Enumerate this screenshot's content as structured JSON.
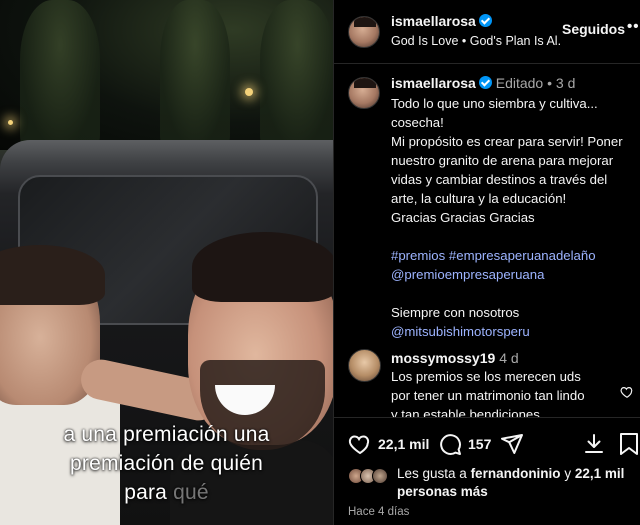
{
  "video": {
    "caption_line1": "a una premiación una",
    "caption_line2": "premiación de quién",
    "caption_line3_start": "para ",
    "caption_line3_faded": "qué"
  },
  "header": {
    "username": "ismaellarosa",
    "subtitle": "God Is Love • God's Plan Is Al...",
    "follow_label": "Seguidos",
    "more_label": "•••"
  },
  "post": {
    "username": "ismaellarosa",
    "edited": "Editado",
    "separator": "•",
    "time": "3 d",
    "lines": [
      "Todo lo que uno siembra y cultiva...",
      "cosecha!",
      "Mi propósito es crear para servir! Poner",
      "nuestro granito de arena para mejorar",
      "vidas y cambiar destinos a través del",
      "arte, la cultura y la educación!",
      "Gracias Gracias Gracias"
    ],
    "hashtag1": "#premios",
    "hashtag2": "#empresaperuanadelaño",
    "mention1": "@premioempresaperuana",
    "closing": "Siempre con nosotros",
    "mention2": "@mitsubishimotorsperu"
  },
  "comment": {
    "username": "mossymossy19",
    "time": "4 d",
    "lines": [
      "Los premios se los merecen uds",
      "por tener un matrimonio tan lindo",
      "y tan estable bendiciones"
    ]
  },
  "actions": {
    "likes_count": "22,1 mil",
    "comments_count": "157"
  },
  "likes": {
    "prefix": "Les gusta a ",
    "user": "fernandoninio",
    "middle": " y ",
    "count": "22,1 mil",
    "suffix": " personas más"
  },
  "timestamp": "Hace 4 días",
  "colors": {
    "verified": "#0095f6",
    "link": "#9db4ff",
    "secondary_text": "#a8a8a8",
    "divider": "#262626"
  }
}
